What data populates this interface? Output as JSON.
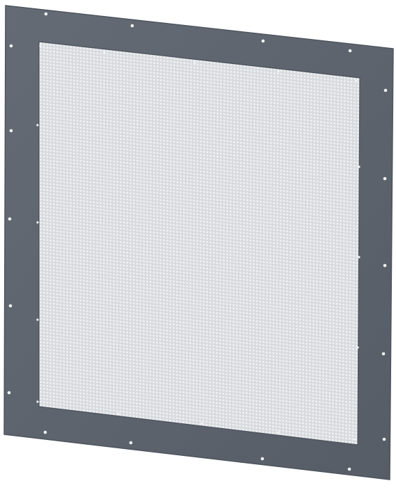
{
  "image": {
    "subject": "perforated-metal-panel",
    "colors": {
      "background": "#ffffff",
      "plate": "#5c636d",
      "plate_edge": "#4e555e",
      "mesh_hole": "#eef0f2",
      "mesh_shadow": "#d6d9dd",
      "mounting_hole": "#f4f5f6"
    },
    "mesh": {
      "columns": 96,
      "rows": 110
    }
  }
}
